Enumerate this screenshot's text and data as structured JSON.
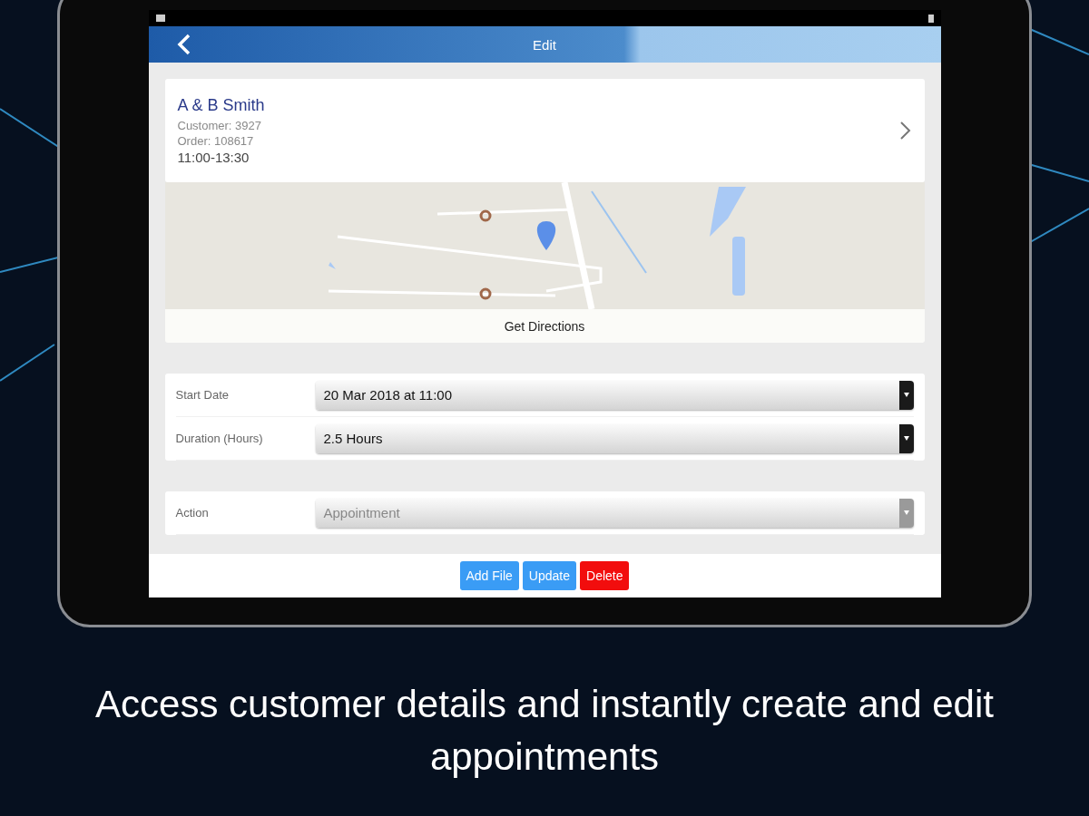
{
  "header": {
    "title": "Edit"
  },
  "customer": {
    "name": "A & B Smith",
    "customer": "Customer: 3927",
    "order": "Order: 108617",
    "time": "11:00-13:30"
  },
  "map": {
    "button": "Get Directions"
  },
  "sections": [
    {
      "fields": [
        {
          "label": "Start Date",
          "value": "20 Mar 2018 at 11:00",
          "disabled": false
        },
        {
          "label": "Duration (Hours)",
          "value": "2.5 Hours",
          "disabled": false
        }
      ]
    },
    {
      "fields": [
        {
          "label": "Action",
          "value": "Appointment",
          "disabled": true
        }
      ]
    }
  ],
  "actions": [
    {
      "label": "Add File",
      "kind": "primary"
    },
    {
      "label": "Update",
      "kind": "primary"
    },
    {
      "label": "Delete",
      "kind": "danger"
    }
  ],
  "caption": "Access customer details and instantly create and edit appointments"
}
